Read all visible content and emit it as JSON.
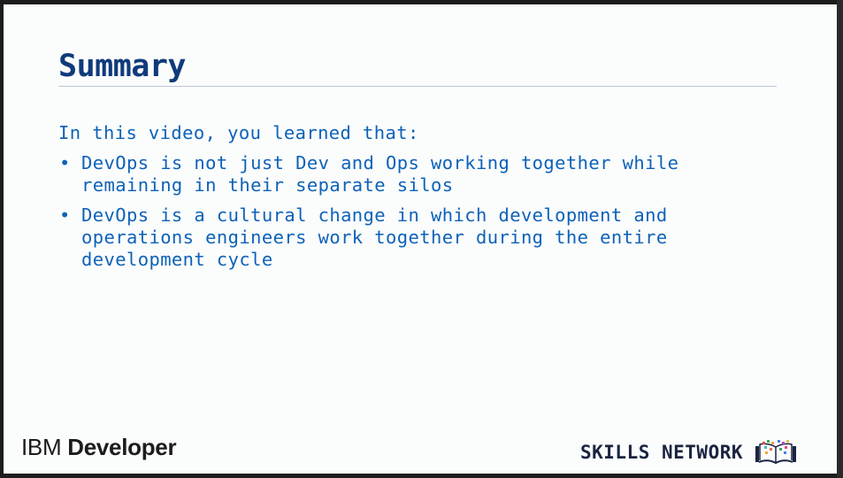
{
  "slide": {
    "title": "Summary",
    "intro": "In this video, you learned that:",
    "bullets": [
      {
        "line1": "DevOps is not just Dev and Ops working together while",
        "line2": "remaining in their separate silos",
        "line3": ""
      },
      {
        "line1": "DevOps is a cultural change in which development and",
        "line2": "operations engineers work together during the entire",
        "line3": "development cycle"
      }
    ],
    "bullet_symbol": "•"
  },
  "footer": {
    "brand_left_prefix": "IBM",
    "brand_left_suffix": "Developer",
    "brand_right": "SKILLS NETWORK",
    "brand_right_icon": "skills-network-book-icon"
  },
  "colors": {
    "title": "#0f3b7c",
    "body_text": "#0d62b8",
    "rule": "#b9c7dd",
    "background": "#fbfcfc"
  }
}
